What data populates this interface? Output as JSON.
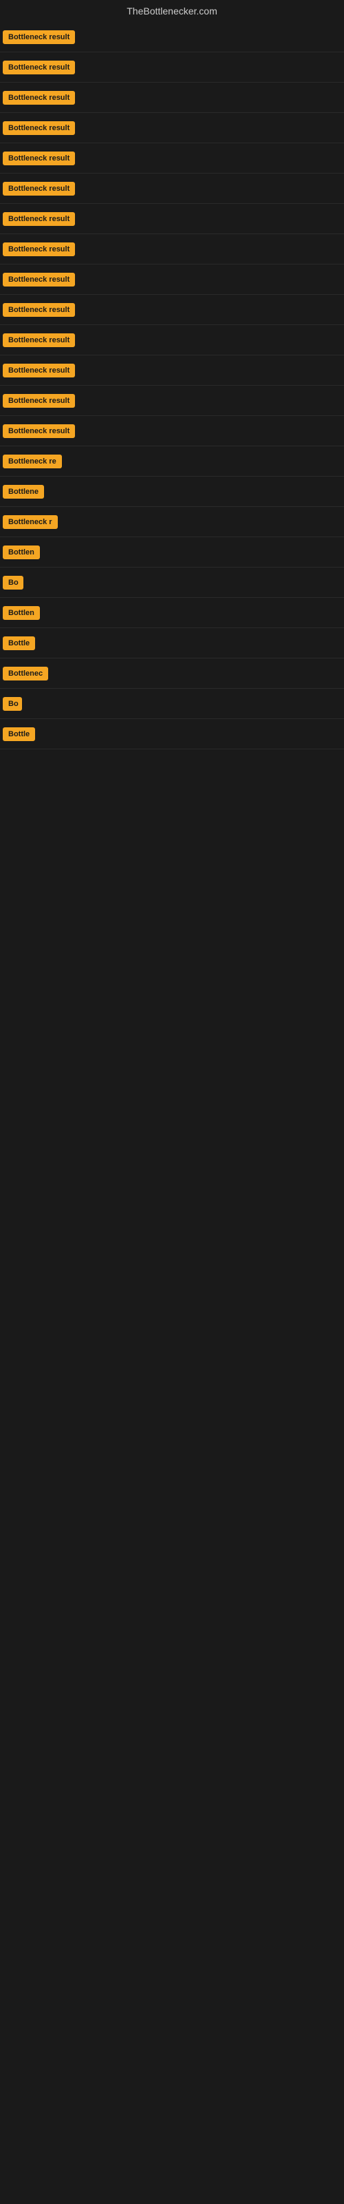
{
  "site": {
    "title": "TheBottlenecker.com"
  },
  "results": [
    {
      "id": 1,
      "label": "Bottleneck result",
      "width": 120
    },
    {
      "id": 2,
      "label": "Bottleneck result",
      "width": 120
    },
    {
      "id": 3,
      "label": "Bottleneck result",
      "width": 120
    },
    {
      "id": 4,
      "label": "Bottleneck result",
      "width": 120
    },
    {
      "id": 5,
      "label": "Bottleneck result",
      "width": 120
    },
    {
      "id": 6,
      "label": "Bottleneck result",
      "width": 120
    },
    {
      "id": 7,
      "label": "Bottleneck result",
      "width": 120
    },
    {
      "id": 8,
      "label": "Bottleneck result",
      "width": 120
    },
    {
      "id": 9,
      "label": "Bottleneck result",
      "width": 120
    },
    {
      "id": 10,
      "label": "Bottleneck result",
      "width": 120
    },
    {
      "id": 11,
      "label": "Bottleneck result",
      "width": 120
    },
    {
      "id": 12,
      "label": "Bottleneck result",
      "width": 120
    },
    {
      "id": 13,
      "label": "Bottleneck result",
      "width": 120
    },
    {
      "id": 14,
      "label": "Bottleneck result",
      "width": 120
    },
    {
      "id": 15,
      "label": "Bottleneck re",
      "width": 95
    },
    {
      "id": 16,
      "label": "Bottlene",
      "width": 75
    },
    {
      "id": 17,
      "label": "Bottleneck r",
      "width": 88
    },
    {
      "id": 18,
      "label": "Bottlen",
      "width": 68
    },
    {
      "id": 19,
      "label": "Bo",
      "width": 30
    },
    {
      "id": 20,
      "label": "Bottlen",
      "width": 68
    },
    {
      "id": 21,
      "label": "Bottle",
      "width": 58
    },
    {
      "id": 22,
      "label": "Bottlenec",
      "width": 78
    },
    {
      "id": 23,
      "label": "Bo",
      "width": 28
    },
    {
      "id": 24,
      "label": "Bottle",
      "width": 55
    }
  ]
}
